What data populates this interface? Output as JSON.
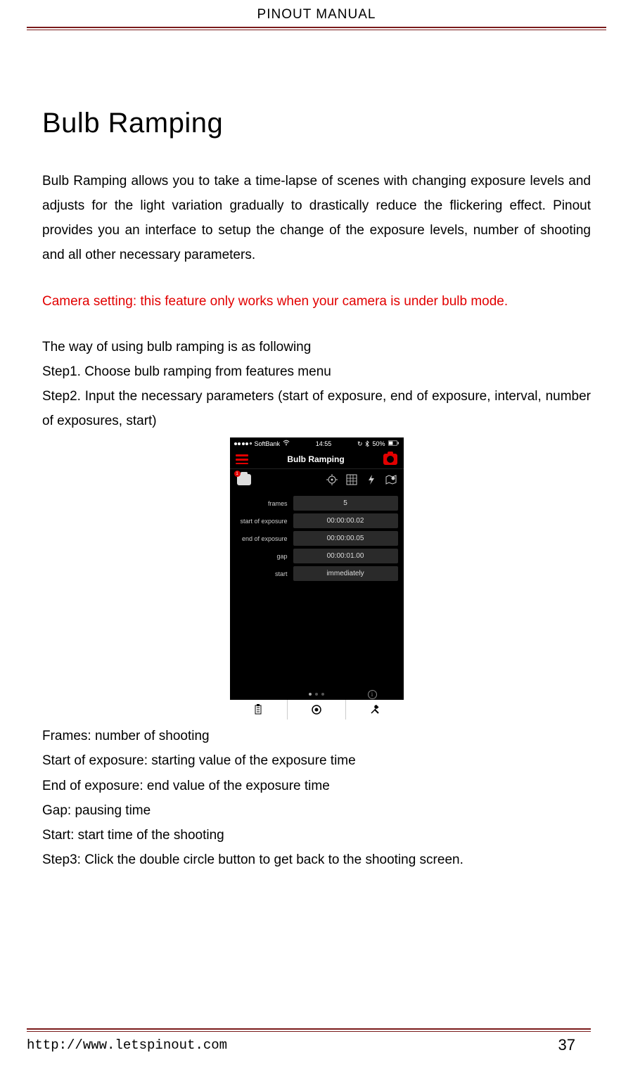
{
  "header": {
    "title": "PINOUT MANUAL"
  },
  "heading": "Bulb Ramping",
  "intro": "Bulb Ramping allows you to take a time-lapse of scenes with changing exposure levels and adjusts for the light variation gradually to drastically reduce the flickering effect. Pinout provides you an interface to setup the change of the exposure levels, number of shooting and all other necessary parameters.",
  "warning": "Camera setting: this feature only works when your camera is under bulb mode.",
  "steps": {
    "intro": "The way of using bulb ramping is as following",
    "s1": "Step1. Choose bulb ramping from features menu",
    "s2": "Step2. Input the necessary parameters (start of exposure, end of exposure, interval, number of exposures, start)",
    "s3": "Step3: Click the double circle button to get back to the shooting screen."
  },
  "phone": {
    "status": {
      "carrier": "SoftBank",
      "wifi": "⌵",
      "time": "14:55",
      "bt": "⋀",
      "battery": "50%"
    },
    "nav": {
      "title": "Bulb Ramping"
    },
    "toolbar": {
      "badge": "1"
    },
    "fields": [
      {
        "label": "frames",
        "value": "5"
      },
      {
        "label": "start of exposure",
        "value": "00:00:00.02"
      },
      {
        "label": "end of exposure",
        "value": "00:00:00.05"
      },
      {
        "label": "gap",
        "value": "00:00:01.00"
      },
      {
        "label": "start",
        "value": "immediately"
      }
    ]
  },
  "definitions": [
    "Frames: number of shooting",
    "Start of exposure: starting value of the exposure time",
    "End of exposure: end value of the exposure time",
    "Gap: pausing time",
    "Start: start time of the shooting"
  ],
  "footer": {
    "url": "http://www.letspinout.com",
    "page": "37"
  }
}
